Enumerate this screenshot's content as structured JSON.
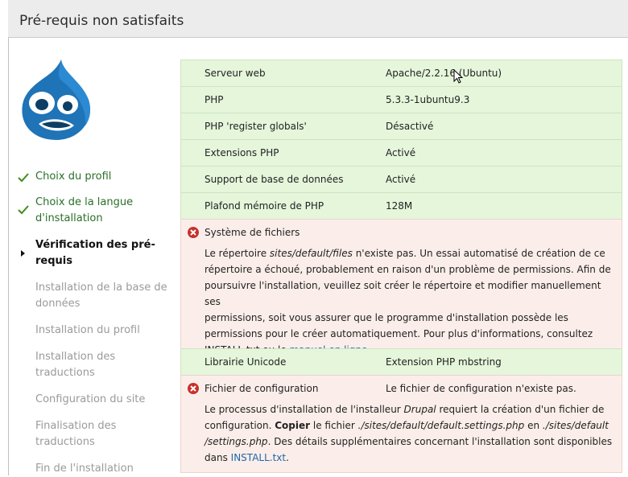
{
  "page": {
    "title": "Pré-requis non satisfaits"
  },
  "colors": {
    "ok_row": "#e5f6db",
    "error_row": "#fbeeea",
    "check": "#3c8f1e",
    "error_icon": "#c8312c",
    "link": "#1f66a8"
  },
  "sidebar": {
    "steps": [
      {
        "label": "Choix du profil",
        "state": "done"
      },
      {
        "label": "Choix de la langue d'installation",
        "state": "done"
      },
      {
        "label": "Vérification des pré-requis",
        "state": "current"
      },
      {
        "label": "Installation de la base de données",
        "state": "pending"
      },
      {
        "label": "Installation du profil",
        "state": "pending"
      },
      {
        "label": "Installation des traductions",
        "state": "pending"
      },
      {
        "label": "Configuration du site",
        "state": "pending"
      },
      {
        "label": "Finalisation des traductions",
        "state": "pending"
      },
      {
        "label": "Fin de l'installation",
        "state": "pending"
      }
    ]
  },
  "requirements": {
    "web_server": {
      "label": "Serveur web",
      "value": "Apache/2.2.16 (Ubuntu)"
    },
    "php": {
      "label": "PHP",
      "value": "5.3.3-1ubuntu9.3"
    },
    "register_globals": {
      "label": "PHP 'register globals'",
      "value": "Désactivé"
    },
    "extensions": {
      "label": "Extensions PHP",
      "value": "Activé"
    },
    "database": {
      "label": "Support de base de données",
      "value": "Activé"
    },
    "memory": {
      "label": "Plafond mémoire de PHP",
      "value": "128M"
    },
    "filesystem": {
      "label": "Système de fichiers",
      "desc_1": "Le répertoire ",
      "desc_path": "sites/default/files",
      "desc_2": " n'existe pas. Un essai automatisé de création de ce",
      "line_2": "répertoire a échoué, probablement en raison d'un problème de permissions. Afin de",
      "line_3": "poursuivre l'installation, veuillez soit créer le répertoire et modifier manuellement ses",
      "line_4": "permissions, soit vous assurer que le programme d'installation possède les",
      "line_5": "permissions pour le créer automatiquement. Pour plus d'informations, consultez",
      "line_6": "INSTALL.txt ou le ",
      "link": "manuel en ligne",
      "line_6_end": "."
    },
    "unicode": {
      "label": "Librairie Unicode",
      "value": "Extension PHP mbstring"
    },
    "config": {
      "label": "Fichier de configuration",
      "value": "Le fichier de configuration n'existe pas.",
      "l1_a": "Le processus d'installation de l'installeur ",
      "l1_b": "Drupal",
      "l1_c": " requiert la création d'un fichier de",
      "l2_a": "configuration. ",
      "l2_b": "Copier",
      "l2_c": " le fichier ",
      "l2_d": "./sites/default/default.settings.php",
      "l2_e": " en ",
      "l2_f": "./sites/default",
      "l3_a": "/settings.php",
      "l3_b": ". Des détails supplémentaires concernant l'installation sont disponibles",
      "l4_a": "dans ",
      "l4_link": "INSTALL.txt",
      "l4_b": "."
    }
  }
}
